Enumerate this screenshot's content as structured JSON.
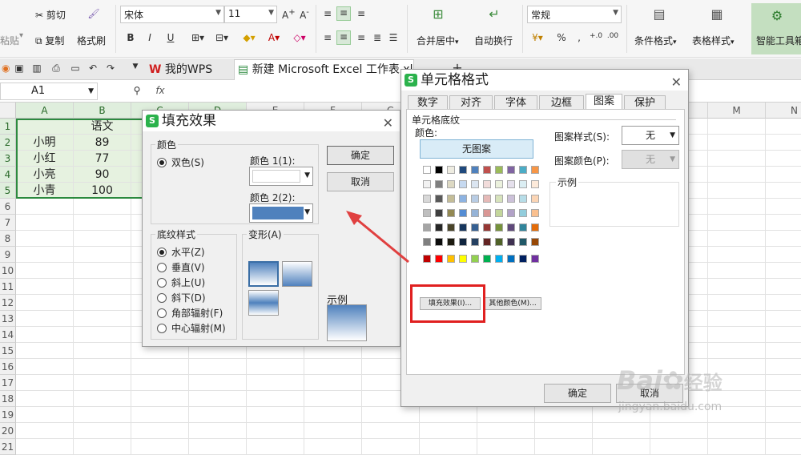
{
  "ribbon": {
    "paste": "粘贴",
    "cut": "剪切",
    "copy": "复制",
    "format_painter": "格式刷",
    "font_name": "宋体",
    "font_size": "11",
    "merge_center": "合并居中",
    "wrap_text": "自动换行",
    "number_format": "常规",
    "conditional_format": "条件格式",
    "table_style": "表格样式",
    "smart_toolbox": "智能工具箱",
    "percent": "%",
    "thousands": ","
  },
  "tabs": {
    "wps_tab": "我的WPS",
    "file_tab": "新建 Microsoft Excel 工作表.xlsx",
    "new_tab": "+"
  },
  "formula_bar": {
    "cell_ref": "A1",
    "fx": "fx"
  },
  "sheet": {
    "columns": [
      "A",
      "B",
      "C",
      "D",
      "E",
      "F",
      "G",
      "H",
      "I",
      "J",
      "K",
      "L",
      "M",
      "N"
    ],
    "rows": [
      "1",
      "2",
      "3",
      "4",
      "5",
      "6",
      "7",
      "8",
      "9",
      "10",
      "11",
      "12",
      "13",
      "14",
      "15",
      "16",
      "17",
      "18",
      "19",
      "20",
      "21"
    ],
    "data": [
      [
        "",
        "语文"
      ],
      [
        "小明",
        "89"
      ],
      [
        "小红",
        "77"
      ],
      [
        "小亮",
        "90"
      ],
      [
        "小青",
        "100"
      ]
    ]
  },
  "fill_dialog": {
    "title": "填充效果",
    "color_group": "颜色",
    "two_colors": "双色(S)",
    "color1_label": "颜色 1(1):",
    "color2_label": "颜色 2(2):",
    "color1": "#ffffff",
    "color2": "#4f81bd",
    "ok": "确定",
    "cancel": "取消",
    "shading_group": "底纹样式",
    "shading_styles": [
      "水平(Z)",
      "垂直(V)",
      "斜上(U)",
      "斜下(D)",
      "角部辐射(F)",
      "中心辐射(M)"
    ],
    "selected_style": 0,
    "variants_group": "变形(A)",
    "sample_label": "示例"
  },
  "format_dialog": {
    "title": "单元格格式",
    "tabs": [
      "数字",
      "对齐",
      "字体",
      "边框",
      "图案",
      "保护"
    ],
    "active_tab": 4,
    "section": "单元格底纹",
    "color_label": "颜色:",
    "no_color": "无图案",
    "fill_effects_btn": "填充效果(I)...",
    "more_colors_btn": "其他颜色(M)...",
    "pattern_style_label": "图案样式(S):",
    "pattern_style_value": "无",
    "pattern_color_label": "图案颜色(P):",
    "pattern_color_value": "无",
    "sample_label": "示例",
    "ok": "确定",
    "cancel": "取消",
    "highlight_color": "#e02020",
    "palette": [
      [
        "#ffffff",
        "#000000",
        "#eeece1",
        "#1f497d",
        "#4f81bd",
        "#c0504d",
        "#9bbb59",
        "#8064a2",
        "#4bacc6",
        "#f79646"
      ],
      [
        "#f2f2f2",
        "#7f7f7f",
        "#ddd9c3",
        "#c6d9f0",
        "#dbe5f1",
        "#f2dcdb",
        "#ebf1dd",
        "#e5e0ec",
        "#dbeef3",
        "#fdeada"
      ],
      [
        "#d8d8d8",
        "#595959",
        "#c4bd97",
        "#8db3e2",
        "#b8cce4",
        "#e5b9b7",
        "#d7e3bc",
        "#ccc1d9",
        "#b7dde8",
        "#fbd5b5"
      ],
      [
        "#bfbfbf",
        "#3f3f3f",
        "#938953",
        "#548dd4",
        "#95b3d7",
        "#d99694",
        "#c3d69b",
        "#b2a2c7",
        "#92cddc",
        "#fac08f"
      ],
      [
        "#a5a5a5",
        "#262626",
        "#494429",
        "#17365d",
        "#366092",
        "#953734",
        "#76923c",
        "#5f497a",
        "#31859b",
        "#e36c09"
      ],
      [
        "#7f7f7f",
        "#0c0c0c",
        "#1d1b10",
        "#0f243e",
        "#244061",
        "#632423",
        "#4f6128",
        "#3f3151",
        "#205867",
        "#974806"
      ],
      [
        "#c00000",
        "#ff0000",
        "#ffc000",
        "#ffff00",
        "#92d050",
        "#00b050",
        "#00b0f0",
        "#0070c0",
        "#002060",
        "#7030a0"
      ]
    ]
  },
  "watermark": {
    "brand": "Bai",
    "brand2": "经验",
    "url": "jingyan.baidu.com"
  }
}
